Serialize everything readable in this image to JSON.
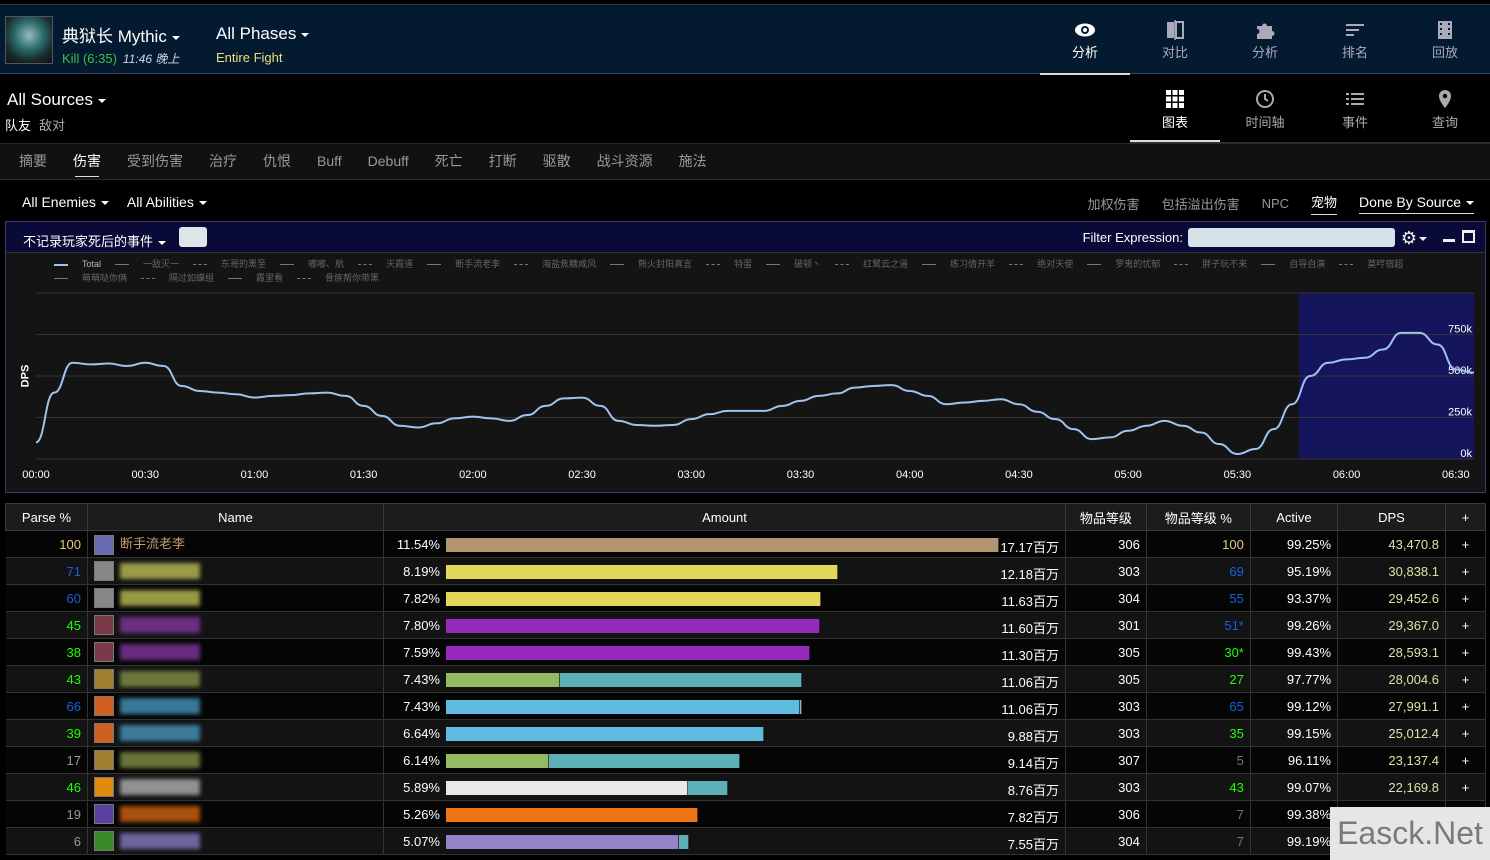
{
  "header": {
    "boss_name": "典狱长 Mythic",
    "result": "Kill (6:35)",
    "time": "11:46 晚上",
    "phase": "All Phases",
    "phase_sub": "Entire Fight"
  },
  "top_nav": [
    {
      "label": "分析",
      "icon": "eye-icon",
      "active": true
    },
    {
      "label": "对比",
      "icon": "compare-icon",
      "active": false
    },
    {
      "label": "分析",
      "icon": "puzzle-icon",
      "active": false
    },
    {
      "label": "排名",
      "icon": "rank-lines-icon",
      "active": false
    },
    {
      "label": "回放",
      "icon": "film-icon",
      "active": false
    }
  ],
  "sources": {
    "title": "All Sources",
    "friendly": "队友",
    "hostile": "敌对"
  },
  "sub_nav": [
    {
      "label": "图表",
      "icon": "grid-icon",
      "active": true
    },
    {
      "label": "时间轴",
      "icon": "clock-icon",
      "active": false
    },
    {
      "label": "事件",
      "icon": "list-icon",
      "active": false
    },
    {
      "label": "查询",
      "icon": "map-pin-icon",
      "active": false
    }
  ],
  "tabs": [
    "摘要",
    "伤害",
    "受到伤害",
    "治疗",
    "仇恨",
    "Buff",
    "Debuff",
    "死亡",
    "打断",
    "驱散",
    "战斗资源",
    "施法"
  ],
  "active_tab": "伤害",
  "filters": {
    "enemies": "All Enemies",
    "abilities": "All Abilities"
  },
  "toggles": {
    "weighted": "加权伤害",
    "overkill": "包括溢出伤害",
    "npc": "NPC",
    "pets": "宠物",
    "view": "Done By Source"
  },
  "chart_panel": {
    "death_filter": "不记录玩家死后的事件",
    "filter_label": "Filter Expression:",
    "filter_value": ""
  },
  "chart_data": {
    "type": "line",
    "title": "",
    "xlabel": "",
    "ylabel": "DPS",
    "x_unit": "seconds",
    "xlim": [
      0,
      395
    ],
    "ylim": [
      0,
      1000000
    ],
    "grid": true,
    "legend_position": "top",
    "x_ticks": [
      "00:00",
      "00:30",
      "01:00",
      "01:30",
      "02:00",
      "02:30",
      "03:00",
      "03:30",
      "04:00",
      "04:30",
      "05:00",
      "05:30",
      "06:00",
      "06:30"
    ],
    "y_ticks": [
      "0k",
      "250k",
      "500k",
      "750k"
    ],
    "highlight_range": [
      347,
      395
    ],
    "legend": [
      "Total",
      "一敌灭一",
      "东哥的黑至",
      "嘟嘟、航",
      "天霞道",
      "断手流老李",
      "海盐焦糖咸风",
      "熊火封阳真言",
      "特蛋",
      "破顿丶",
      "红鹭云之道",
      "练习倩开羊",
      "绝对天使",
      "罗鬼的忧郁",
      "胖子玩不来",
      "自导自演",
      "莫哼宿超",
      "萌萌哒你俩",
      "隔过如蝶组",
      "霞里看",
      "骨族帮你带黑"
    ],
    "series": [
      {
        "name": "Total",
        "color": "#9fc3ef",
        "x": [
          0,
          5,
          10,
          15,
          20,
          25,
          30,
          35,
          40,
          45,
          50,
          55,
          60,
          65,
          70,
          75,
          80,
          85,
          90,
          95,
          100,
          105,
          110,
          115,
          120,
          125,
          130,
          135,
          140,
          145,
          150,
          155,
          160,
          165,
          170,
          175,
          180,
          185,
          190,
          195,
          200,
          205,
          210,
          215,
          220,
          225,
          230,
          235,
          240,
          245,
          250,
          255,
          260,
          265,
          270,
          275,
          280,
          285,
          290,
          295,
          300,
          305,
          310,
          315,
          320,
          325,
          330,
          335,
          340,
          345,
          350,
          355,
          360,
          365,
          370,
          375,
          380,
          385,
          390,
          395
        ],
        "y": [
          100000,
          400000,
          580000,
          570000,
          575000,
          560000,
          580000,
          560000,
          440000,
          410000,
          400000,
          390000,
          370000,
          380000,
          385000,
          395000,
          400000,
          380000,
          320000,
          260000,
          200000,
          190000,
          215000,
          245000,
          255000,
          245000,
          230000,
          265000,
          320000,
          365000,
          370000,
          320000,
          230000,
          205000,
          200000,
          205000,
          240000,
          270000,
          290000,
          290000,
          290000,
          320000,
          350000,
          380000,
          395000,
          430000,
          440000,
          445000,
          410000,
          380000,
          330000,
          340000,
          350000,
          360000,
          330000,
          285000,
          240000,
          180000,
          120000,
          130000,
          170000,
          200000,
          230000,
          200000,
          160000,
          90000,
          30000,
          60000,
          180000,
          330000,
          500000,
          580000,
          600000,
          610000,
          660000,
          760000,
          760000,
          690000,
          540000,
          520000
        ]
      }
    ]
  },
  "table": {
    "headers": [
      "Parse %",
      "Name",
      "Amount",
      "物品等级",
      "物品等级 %",
      "Active",
      "DPS",
      "+"
    ],
    "rows": [
      {
        "parse": "100",
        "parse_color": "#e5cc80",
        "name": "断手流老李",
        "name_color": "#c69b6d",
        "icon_color": "#6a6ab0",
        "pct": "11.54%",
        "amount": "17.17百万",
        "share": 1.0,
        "segments": [
          {
            "frac": 1.0,
            "color": "#b39572"
          }
        ],
        "ilvl": "306",
        "ilvl_pct": "100",
        "ilvl_pct_color": "#e5cc80",
        "active": "99.25%",
        "dps": "43,470.8"
      },
      {
        "parse": "71",
        "parse_color": "#1a5fde",
        "name": "",
        "name_color": "#c8c85a",
        "icon_color": "#888",
        "pct": "8.19%",
        "amount": "12.18百万",
        "share": 0.7094,
        "segments": [
          {
            "frac": 1.0,
            "color": "#e4d85a"
          }
        ],
        "ilvl": "303",
        "ilvl_pct": "69",
        "ilvl_pct_color": "#1a5fde",
        "active": "95.19%",
        "dps": "30,838.1"
      },
      {
        "parse": "60",
        "parse_color": "#1a5fde",
        "name": "",
        "name_color": "#c8c85a",
        "icon_color": "#888",
        "pct": "7.82%",
        "amount": "11.63百万",
        "share": 0.6774,
        "segments": [
          {
            "frac": 1.0,
            "color": "#e4d85a"
          }
        ],
        "ilvl": "304",
        "ilvl_pct": "55",
        "ilvl_pct_color": "#1a5fde",
        "active": "93.37%",
        "dps": "29,452.6"
      },
      {
        "parse": "45",
        "parse_color": "#1eff00",
        "name": "",
        "name_color": "#8a3aa8",
        "icon_color": "#7a3a4a",
        "pct": "7.80%",
        "amount": "11.60百万",
        "share": 0.6756,
        "segments": [
          {
            "frac": 1.0,
            "color": "#962bbb"
          }
        ],
        "ilvl": "301",
        "ilvl_pct": "51*",
        "ilvl_pct_color": "#1a5fde",
        "active": "99.26%",
        "dps": "29,367.0"
      },
      {
        "parse": "38",
        "parse_color": "#1eff00",
        "name": "",
        "name_color": "#8a3aa8",
        "icon_color": "#7a3a4a",
        "pct": "7.59%",
        "amount": "11.30百万",
        "share": 0.6581,
        "segments": [
          {
            "frac": 1.0,
            "color": "#962bbb"
          }
        ],
        "ilvl": "305",
        "ilvl_pct": "30*",
        "ilvl_pct_color": "#1eff00",
        "active": "99.43%",
        "dps": "28,593.1"
      },
      {
        "parse": "43",
        "parse_color": "#1eff00",
        "name": "",
        "name_color": "#8a9a4a",
        "icon_color": "#a08030",
        "pct": "7.43%",
        "amount": "11.06百万",
        "share": 0.6441,
        "segments": [
          {
            "frac": 0.32,
            "color": "#94bb63"
          },
          {
            "frac": 0.68,
            "color": "#5eb0b8"
          }
        ],
        "ilvl": "305",
        "ilvl_pct": "27",
        "ilvl_pct_color": "#1eff00",
        "active": "97.77%",
        "dps": "28,004.6"
      },
      {
        "parse": "66",
        "parse_color": "#1a5fde",
        "name": "",
        "name_color": "#4aa0c8",
        "icon_color": "#d06020",
        "pct": "7.43%",
        "amount": "11.06百万",
        "share": 0.6441,
        "segments": [
          {
            "frac": 0.995,
            "color": "#5fbbe0"
          },
          {
            "frac": 0.005,
            "color": "#aaaaaa"
          }
        ],
        "ilvl": "303",
        "ilvl_pct": "65",
        "ilvl_pct_color": "#1a5fde",
        "active": "99.12%",
        "dps": "27,991.1"
      },
      {
        "parse": "39",
        "parse_color": "#1eff00",
        "name": "",
        "name_color": "#4aa0c8",
        "icon_color": "#d06020",
        "pct": "6.64%",
        "amount": "9.88百万",
        "share": 0.5754,
        "segments": [
          {
            "frac": 1.0,
            "color": "#5fbbe0"
          }
        ],
        "ilvl": "303",
        "ilvl_pct": "35",
        "ilvl_pct_color": "#1eff00",
        "active": "99.15%",
        "dps": "25,012.4"
      },
      {
        "parse": "17",
        "parse_color": "#999999",
        "name": "",
        "name_color": "#8a9a4a",
        "icon_color": "#a08030",
        "pct": "6.14%",
        "amount": "9.14百万",
        "share": 0.5323,
        "segments": [
          {
            "frac": 0.35,
            "color": "#94bb63"
          },
          {
            "frac": 0.65,
            "color": "#5eb0b8"
          }
        ],
        "ilvl": "307",
        "ilvl_pct": "5",
        "ilvl_pct_color": "#777777",
        "active": "96.11%",
        "dps": "23,137.4"
      },
      {
        "parse": "46",
        "parse_color": "#1eff00",
        "name": "",
        "name_color": "#bbbbbb",
        "icon_color": "#e08a10",
        "pct": "5.89%",
        "amount": "8.76百万",
        "share": 0.5102,
        "segments": [
          {
            "frac": 0.857,
            "color": "#e8e8e8"
          },
          {
            "frac": 0.143,
            "color": "#5eb0b8"
          }
        ],
        "ilvl": "303",
        "ilvl_pct": "43",
        "ilvl_pct_color": "#1eff00",
        "active": "99.07%",
        "dps": "22,169.8"
      },
      {
        "parse": "19",
        "parse_color": "#999999",
        "name": "",
        "name_color": "#e06a10",
        "icon_color": "#5a40a0",
        "pct": "5.26%",
        "amount": "7.82百万",
        "share": 0.4554,
        "segments": [
          {
            "frac": 1.0,
            "color": "#ed7514"
          }
        ],
        "ilvl": "306",
        "ilvl_pct": "7",
        "ilvl_pct_color": "#777777",
        "active": "99.38%",
        "dps": ""
      },
      {
        "parse": "6",
        "parse_color": "#999999",
        "name": "",
        "name_color": "#8a80c8",
        "icon_color": "#3a8a2a",
        "pct": "5.07%",
        "amount": "7.55百万",
        "share": 0.4397,
        "segments": [
          {
            "frac": 0.96,
            "color": "#9682c8"
          },
          {
            "frac": 0.04,
            "color": "#5eb0b8"
          }
        ],
        "ilvl": "304",
        "ilvl_pct": "7",
        "ilvl_pct_color": "#777777",
        "active": "99.19%",
        "dps": ""
      }
    ]
  },
  "watermark": "Easck.Net"
}
